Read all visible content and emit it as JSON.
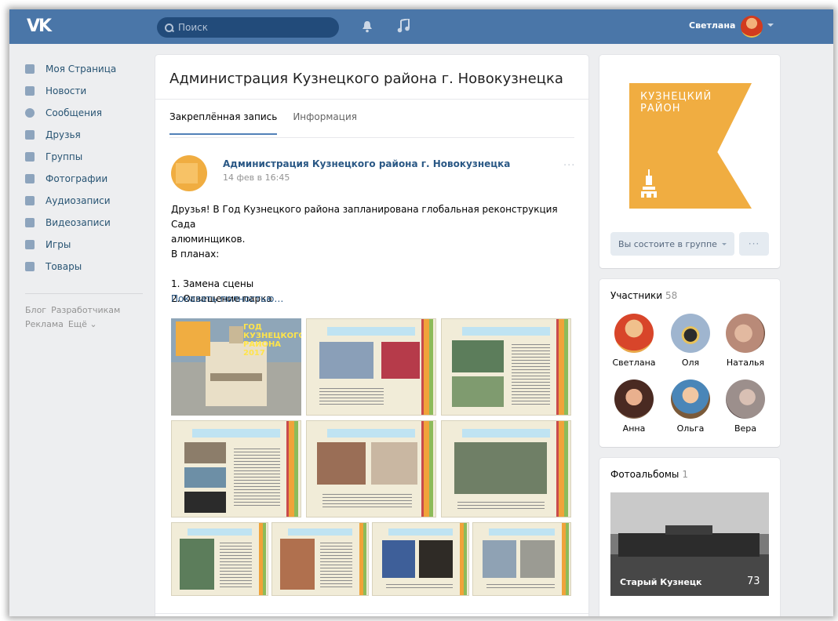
{
  "header": {
    "logo": "VK",
    "search_placeholder": "Поиск",
    "user_name": "Светлана"
  },
  "sidebar": {
    "items": [
      {
        "label": "Моя Страница",
        "icon": "home-icon"
      },
      {
        "label": "Новости",
        "icon": "news-icon"
      },
      {
        "label": "Сообщения",
        "icon": "messages-icon"
      },
      {
        "label": "Друзья",
        "icon": "friends-icon"
      },
      {
        "label": "Группы",
        "icon": "groups-icon"
      },
      {
        "label": "Фотографии",
        "icon": "camera-icon"
      },
      {
        "label": "Аудиозаписи",
        "icon": "music-note-icon"
      },
      {
        "label": "Видеозаписи",
        "icon": "film-icon"
      },
      {
        "label": "Игры",
        "icon": "gamepad-icon"
      },
      {
        "label": "Товары",
        "icon": "shopping-bag-icon"
      }
    ],
    "footer": [
      "Блог",
      "Разработчикам",
      "Реклама",
      "Ещё ⌄"
    ]
  },
  "group": {
    "title": "Администрация Кузнецкого района г. Новокузнецка",
    "tabs": [
      "Закреплённая запись",
      "Информация"
    ]
  },
  "post": {
    "author": "Администрация Кузнецкого района г. Новокузнецка",
    "date": "14 фев в 16:45",
    "more": "···",
    "text": [
      "Друзья! В Год Кузнецкого района запланирована глобальная реконструкция Сада",
      "алюминщиков.",
      "В планах:",
      "",
      "1. Замена сцены",
      "2. Освещение парка"
    ],
    "show_more": "Показать полностью…",
    "cover_text": [
      "ГОД",
      "КУЗНЕЦКОГО",
      "РАЙОНА",
      "2017"
    ]
  },
  "right": {
    "logo_text": [
      "КУЗНЕЦКИЙ",
      "РАЙОН"
    ],
    "member_button": "Вы состоите в группе",
    "more_button": "···",
    "members_label": "Участники",
    "members_count": "58",
    "members": [
      {
        "name": "Светлана",
        "color": "#d8452a"
      },
      {
        "name": "Оля",
        "color": "#6f7fa0"
      },
      {
        "name": "Наталья",
        "color": "#b98a78"
      },
      {
        "name": "Анна",
        "color": "#6b3a2e"
      },
      {
        "name": "Ольга",
        "color": "#4a86b8"
      },
      {
        "name": "Вера",
        "color": "#9c8f8c"
      }
    ],
    "albums_label": "Фотоальбомы",
    "albums_count": "1",
    "album": {
      "title": "Старый Кузнецк",
      "count": "73"
    }
  },
  "colors": {
    "header": "#4a76a8",
    "link": "#2a5885",
    "accent_orange": "#f0ad41"
  }
}
